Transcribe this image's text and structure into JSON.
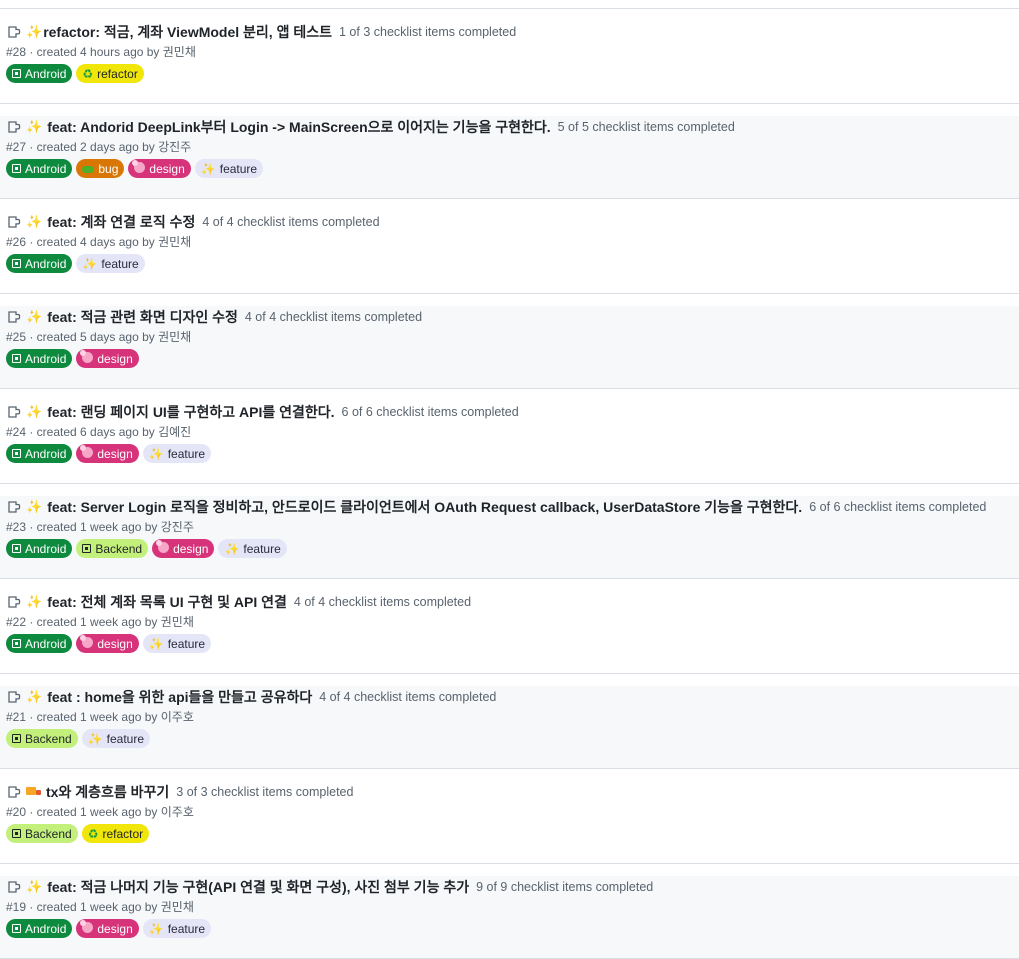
{
  "labels_meta": {
    "Android": {
      "cls": "lab-android",
      "icon": "android-square-icon"
    },
    "refactor": {
      "cls": "lab-refactor",
      "icon": "recycle-icon"
    },
    "bug": {
      "cls": "lab-bug",
      "icon": "bug-icon"
    },
    "design": {
      "cls": "lab-design",
      "icon": "design-blob-icon"
    },
    "feature": {
      "cls": "lab-feature",
      "icon": "sparkles-icon"
    },
    "Backend": {
      "cls": "lab-backend",
      "icon": "backend-square-icon"
    }
  },
  "prs": [
    {
      "title_emoji": "✨",
      "title": "refactor: 적금, 계좌 ViewModel 분리, 앱 테스트",
      "checklist": "1 of 3 checklist items completed",
      "meta": "#28 · created 4 hours ago by 권민채",
      "labels": [
        "Android",
        "refactor"
      ],
      "tight": true
    },
    {
      "title_emoji": "✨",
      "title": "feat: Andorid DeepLink부터 Login -> MainScreen으로 이어지는 기능을 구현한다.",
      "checklist": "5 of 5 checklist items completed",
      "meta": "#27 · created 2 days ago by 강진주",
      "labels": [
        "Android",
        "bug",
        "design",
        "feature"
      ]
    },
    {
      "title_emoji": "✨",
      "title": "feat: 계좌 연결 로직 수정",
      "checklist": "4 of 4 checklist items completed",
      "meta": "#26 · created 4 days ago by 권민채",
      "labels": [
        "Android",
        "feature"
      ]
    },
    {
      "title_emoji": "✨",
      "title": "feat: 적금 관련 화면 디자인 수정",
      "checklist": "4 of 4 checklist items completed",
      "meta": "#25 · created 5 days ago by 권민채",
      "labels": [
        "Android",
        "design"
      ]
    },
    {
      "title_emoji": "✨",
      "title": "feat: 랜딩 페이지 UI를 구현하고 API를 연결한다.",
      "checklist": "6 of 6 checklist items completed",
      "meta": "#24 · created 6 days ago by 김예진",
      "labels": [
        "Android",
        "design",
        "feature"
      ]
    },
    {
      "title_emoji": "✨",
      "title": "feat: Server Login 로직을 정비하고, 안드로이드 클라이언트에서 OAuth Request callback, UserDataStore 기능을 구현한다.",
      "checklist": "6 of 6 checklist items completed",
      "meta": "#23 · created 1 week ago by 강진주",
      "labels": [
        "Android",
        "Backend",
        "design",
        "feature"
      ]
    },
    {
      "title_emoji": "✨",
      "title": "feat: 전체 계좌 목록 UI 구현 및 API 연결",
      "checklist": "4 of 4 checklist items completed",
      "meta": "#22 · created 1 week ago by 권민채",
      "labels": [
        "Android",
        "design",
        "feature"
      ]
    },
    {
      "title_emoji": "✨",
      "title": "feat : home을 위한 api들을 만들고 공유하다",
      "checklist": "4 of 4 checklist items completed",
      "meta": "#21 · created 1 week ago by 이주호",
      "labels": [
        "Backend",
        "feature"
      ]
    },
    {
      "title_emoji": "🚚",
      "title": "tx와 계층흐름 바꾸기",
      "checklist": "3 of 3 checklist items completed",
      "meta": "#20 · created 1 week ago by 이주호",
      "labels": [
        "Backend",
        "refactor"
      ]
    },
    {
      "title_emoji": "✨",
      "title": "feat: 적금 나머지 기능 구현(API 연결 및 화면 구성), 사진 첨부 기능 추가",
      "checklist": "9 of 9 checklist items completed",
      "meta": "#19 · created 1 week ago by 권민채",
      "labels": [
        "Android",
        "design",
        "feature"
      ]
    }
  ]
}
